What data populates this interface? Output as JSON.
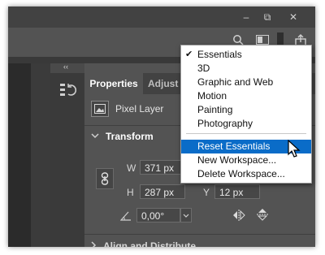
{
  "window": {
    "controls": [
      "–",
      "⧉",
      "✕"
    ]
  },
  "panel": {
    "collapse_glyph": "‹‹",
    "tabs": {
      "active": "Properties",
      "inactive": "Adjust"
    },
    "layer_type": "Pixel Layer",
    "transform": {
      "title": "Transform",
      "w_label": "W",
      "w_value": "371 px",
      "h_label": "H",
      "h_value": "287 px",
      "y_label": "Y",
      "y_value": "12 px",
      "angle_value": "0,00°"
    },
    "next_section": "Align and Distribute"
  },
  "workspace_menu": {
    "items": [
      {
        "label": "Essentials",
        "checked": true
      },
      {
        "label": "3D"
      },
      {
        "label": "Graphic and Web"
      },
      {
        "label": "Motion"
      },
      {
        "label": "Painting"
      },
      {
        "label": "Photography"
      }
    ],
    "actions": [
      {
        "label": "Reset Essentials",
        "highlighted": true
      },
      {
        "label": "New Workspace..."
      },
      {
        "label": "Delete Workspace..."
      }
    ]
  },
  "colors": {
    "accent": "#0a6cc8",
    "panel_bg": "#535353",
    "titlebar_bg": "#424242"
  },
  "icons": [
    "minimize-icon",
    "restore-icon",
    "close-icon",
    "history-icon",
    "layer-thumbnail-icon",
    "chevron-down-icon",
    "link-icon",
    "angle-icon",
    "flip-horizontal-icon",
    "flip-vertical-icon",
    "search-icon",
    "workspace-icon",
    "share-icon",
    "checkmark-icon",
    "pointer-cursor-icon"
  ]
}
